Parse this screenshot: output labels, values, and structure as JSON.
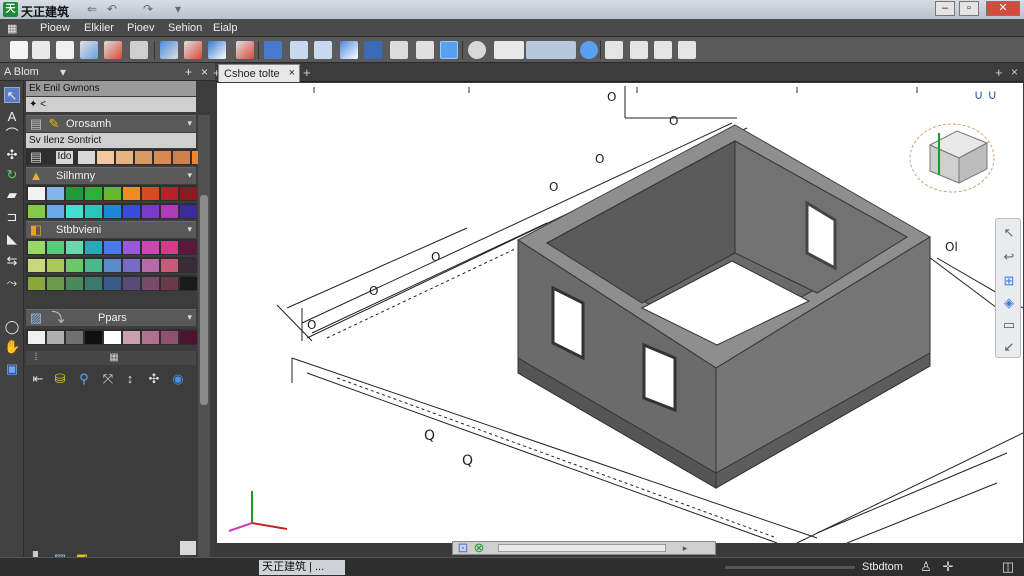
{
  "titlebar": {
    "logo": "天",
    "app_title": "天正建筑"
  },
  "menubar": {
    "items": [
      "Pioew",
      "Elkiler",
      "Pioev",
      "Sehion",
      "Eialp"
    ]
  },
  "left_panel": {
    "title": "A Blom",
    "search_header": "Ek Enil Gwnons",
    "search_value": "<",
    "sections": {
      "s1": "Orosamh",
      "s2_header": "Sv Ilenz Sontrict",
      "s2_item": "Ido",
      "s3": "Silhmny",
      "s4": "Stbbvieni",
      "s5": "Ppars"
    },
    "colors": {
      "row_a": [
        "#d7d7d7",
        "#f3c8a0",
        "#e9b37f",
        "#d99a62",
        "#d98952",
        "#cf7f4a",
        "#e88838"
      ],
      "row_b": [
        "#f2f2f2",
        "#86b3e8",
        "#1e9c3a",
        "#2bb03a",
        "#64b82a",
        "#f08c22",
        "#d74b1e",
        "#b8202a",
        "#8a1a24"
      ],
      "row_c": [
        "#85c84a",
        "#6aa8e8",
        "#40e0d0",
        "#28c8b8",
        "#1a8ad8",
        "#3a4ae0",
        "#7a3ac8",
        "#b03ab8",
        "#3a2a9a"
      ],
      "row_d": [
        "#9ad86a",
        "#5ac87a",
        "#6ad8aa",
        "#2aa8b8",
        "#4a7ae8",
        "#9a5ad8",
        "#c84ab0",
        "#d83a8a",
        "#5a1a3a"
      ],
      "row_e": [
        "#c8d87a",
        "#aac85a",
        "#6ac86a",
        "#4ab88a",
        "#5a8ac8",
        "#7a6ac8",
        "#b86aa8",
        "#c85a7a",
        "#3a2a3a"
      ],
      "row_f": [
        "#8aa83a",
        "#6a9a4a",
        "#4a8a5a",
        "#3a7a6a",
        "#3a5a8a",
        "#5a4a7a",
        "#7a4a6a",
        "#6a3a4a",
        "#1a1a1a"
      ],
      "row_g": [
        "#f0f0f0",
        "#b0b0b0",
        "#707070",
        "#101010",
        "#ffffff",
        "#c8a0b0",
        "#b07090",
        "#905070",
        "#501030"
      ]
    }
  },
  "tab": {
    "label": "Cshoe tolte"
  },
  "drawing": {
    "labels": [
      "O",
      "O",
      "O",
      "O",
      "O",
      "O",
      "O",
      "Ol",
      "Q",
      "Q"
    ]
  },
  "statusbar": {
    "left": "天正建筑 | ...",
    "right": "Stbdtom"
  }
}
